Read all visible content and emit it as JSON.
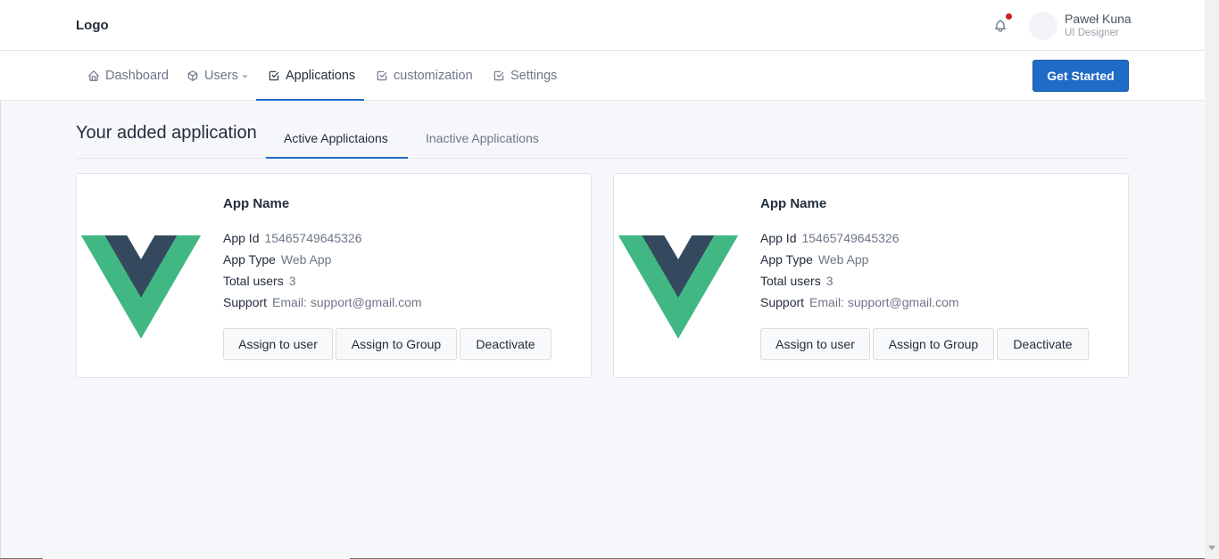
{
  "header": {
    "logo": "Logo",
    "user": {
      "name": "Paweł Kuna",
      "role": "UI Designer"
    },
    "notification_icon": "bell-icon"
  },
  "nav": {
    "items": [
      {
        "label": "Dashboard",
        "icon": "home-icon"
      },
      {
        "label": "Users",
        "icon": "package-icon"
      },
      {
        "label": "Applications",
        "icon": "checkbox-icon"
      },
      {
        "label": "customization",
        "icon": "checkbox-icon"
      },
      {
        "label": "Settings",
        "icon": "checkbox-icon"
      }
    ],
    "active": "Applications",
    "cta": "Get Started"
  },
  "content": {
    "title": "Your added application",
    "tabs": [
      {
        "label": "Active Applictaions"
      },
      {
        "label": "Inactive Applications"
      }
    ],
    "active_tab": "Active Applictaions",
    "cards": [
      {
        "name": "App Name",
        "fields": [
          {
            "key": "App Id",
            "value": "15465749645326"
          },
          {
            "key": "App Type",
            "value": "Web App"
          },
          {
            "key": "Total users",
            "value": "3"
          },
          {
            "key": "Support",
            "value": "Email: support@gmail.com"
          }
        ],
        "buttons": [
          "Assign to user",
          "Assign to Group",
          "Deactivate"
        ]
      },
      {
        "name": "App Name",
        "fields": [
          {
            "key": "App Id",
            "value": "15465749645326"
          },
          {
            "key": "App Type",
            "value": "Web App"
          },
          {
            "key": "Total users",
            "value": "3"
          },
          {
            "key": "Support",
            "value": "Email: support@gmail.com"
          }
        ],
        "buttons": [
          "Assign to user",
          "Assign to Group",
          "Deactivate"
        ]
      }
    ]
  },
  "colors": {
    "primary": "#206bc4",
    "vue_green": "#41b883",
    "vue_dark": "#35495e",
    "notification": "#cd201f"
  }
}
